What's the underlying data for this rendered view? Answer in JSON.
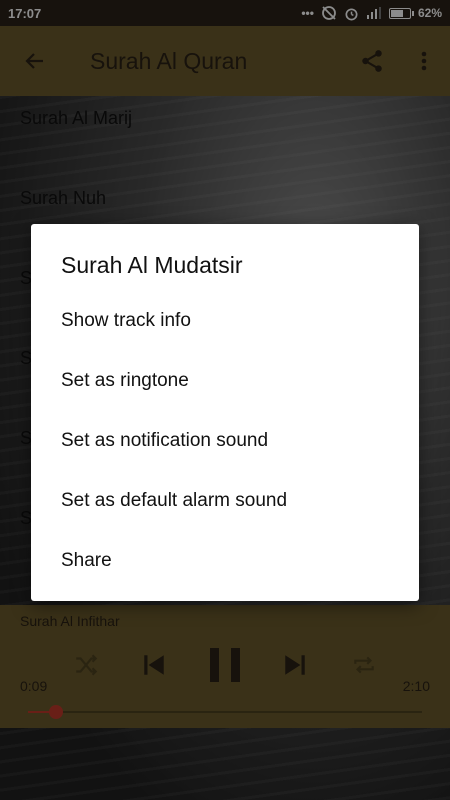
{
  "status_bar": {
    "time": "17:07",
    "battery_percent_label": "62%",
    "battery_level": 0.62
  },
  "app_bar": {
    "title": "Surah Al Quran",
    "back_icon": "arrow-left-icon",
    "share_icon": "share-icon",
    "menu_icon": "more-vert-icon"
  },
  "list": {
    "items": [
      {
        "label": "Surah Al Marij"
      },
      {
        "label": "Surah Nuh"
      },
      {
        "label": "S"
      },
      {
        "label": "S"
      },
      {
        "label": "S"
      },
      {
        "label": "S"
      }
    ]
  },
  "dialog": {
    "title": "Surah Al Mudatsir",
    "options": [
      {
        "label": "Show track info"
      },
      {
        "label": "Set as ringtone"
      },
      {
        "label": "Set as notification sound"
      },
      {
        "label": "Set as default alarm sound"
      },
      {
        "label": "Share"
      }
    ]
  },
  "player": {
    "track_title": "Surah Al Infithar",
    "elapsed": "0:09",
    "duration": "2:10",
    "progress": 0.07,
    "accent_color": "#c0392b"
  },
  "colors": {
    "app_bar": "#6b5a2c",
    "status_bar": "#2a2218",
    "dialog_bg": "#ffffff"
  }
}
